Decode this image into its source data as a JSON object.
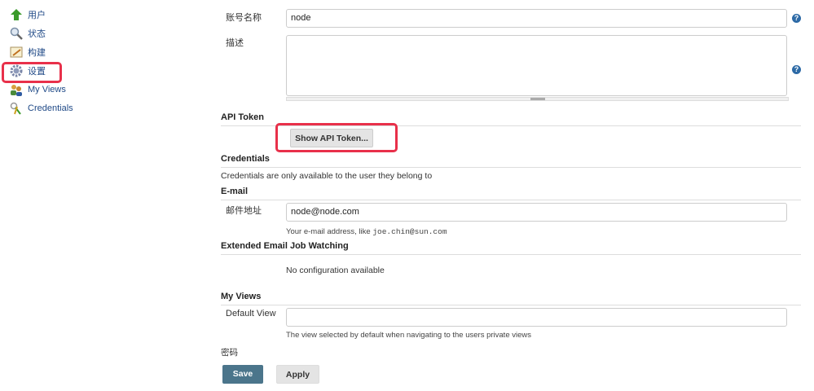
{
  "sidebar": {
    "items": [
      {
        "label": "用户",
        "icon": "up-arrow-icon"
      },
      {
        "label": "状态",
        "icon": "search-icon"
      },
      {
        "label": "构建",
        "icon": "notepad-icon"
      },
      {
        "label": "设置",
        "icon": "gear-icon"
      },
      {
        "label": "My Views",
        "icon": "users-icon"
      },
      {
        "label": "Credentials",
        "icon": "keys-icon"
      }
    ]
  },
  "form": {
    "account_name_label": "账号名称",
    "account_name_value": "node",
    "description_label": "描述",
    "description_value": "",
    "help_label": "?",
    "api_token_header": "API Token",
    "show_api_token_button": "Show API Token...",
    "credentials_header": "Credentials",
    "credentials_text": "Credentials are only available to the user they belong to",
    "email_header": "E-mail",
    "email_label": "邮件地址",
    "email_value": "node@node.com",
    "email_hint": "Your e-mail address, like ",
    "email_hint_example": "joe.chin@sun.com",
    "ext_email_header": "Extended Email Job Watching",
    "ext_email_text": "No configuration available",
    "my_views_header": "My Views",
    "default_view_label": "Default View",
    "default_view_value": "",
    "default_view_hint": "The view selected by default when navigating to the users private views",
    "password_label": "密码",
    "save_button": "Save",
    "apply_button": "Apply"
  },
  "colors": {
    "highlight": "#e8304a",
    "save": "#4b758b",
    "link": "#204a87"
  }
}
